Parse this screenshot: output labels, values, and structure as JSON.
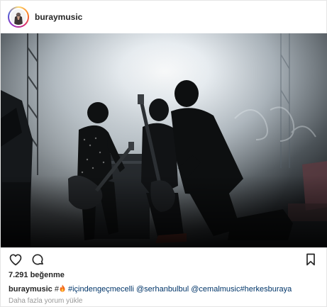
{
  "post": {
    "username": "buraymusic",
    "likes": "7.291 beğenme",
    "caption": {
      "user": "buraymusic",
      "hash": "#",
      "flame_icon": "fire-emoji",
      "tag_1": "#içindengeçmecelli",
      "mention_1": "@serhanbulbul",
      "mention_2": "@cemalmusic",
      "tag_2": "#herkesburaya"
    },
    "load_more": "Daha fazla yorum yükle"
  },
  "icons": {
    "like": "heart-outline-icon",
    "comment": "speech-bubble-icon",
    "save": "bookmark-icon"
  },
  "colors": {
    "text": "#262626",
    "link": "#003569",
    "muted": "#999999",
    "border": "#e6e6e6"
  }
}
